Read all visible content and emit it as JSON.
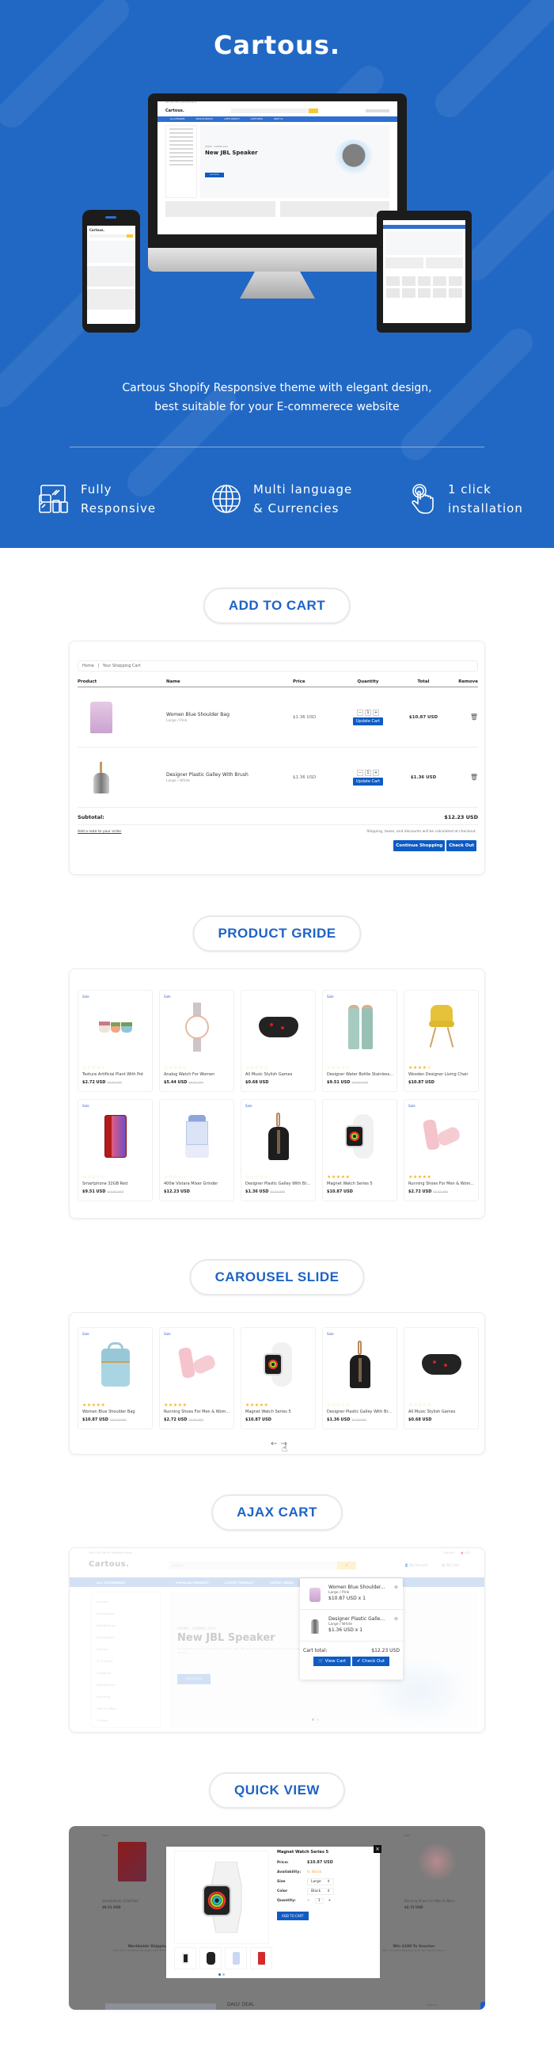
{
  "hero": {
    "title": "Cartous.",
    "description_line1": "Cartous Shopify Responsive theme with elegant design,",
    "description_line2": "best suitable for your E-commerece website",
    "mockup": {
      "promo_bar": "Get 20% Off On Selected Items",
      "logo": "Cartous.",
      "nav": [
        "ALL CATEGORIES",
        "POPULAR PRODUCT",
        "LATEST PRODUCT",
        "LATEST NEWS",
        "ABOUT US"
      ],
      "banner_kicker": "SPRING - SUMMER 2020",
      "banner_title": "New JBL Speaker",
      "banner_button": "SHOP NOW"
    },
    "features": [
      {
        "icon": "responsive-devices-icon",
        "line1": "Fully",
        "line2": "Responsive"
      },
      {
        "icon": "globe-icon",
        "line1": "Multi language",
        "line2": "& Currencies"
      },
      {
        "icon": "touch-click-icon",
        "line1": "1 click",
        "line2": "installation"
      }
    ]
  },
  "sections": {
    "add_to_cart": "ADD TO CART",
    "product_grid": "PRODUCT GRIDE",
    "carousel": "CAROUSEL SLIDE",
    "ajax_cart": "AJAX CART",
    "quick_view": "QUICK VIEW"
  },
  "cart": {
    "breadcrumb": {
      "home": "Home",
      "separator": "|",
      "current": "Your Shopping Cart"
    },
    "columns": [
      "Product",
      "Name",
      "Price",
      "Quantity",
      "Total",
      "Remove"
    ],
    "rows": [
      {
        "name": "Women Blue Shoulder Bag",
        "variant": "Large / Pink",
        "price": "$1.36 USD",
        "qty": "1",
        "total": "$10.87 USD",
        "update_label": "Update Cart",
        "image": "pink-backpack"
      },
      {
        "name": "Designer Plastic Galley With Brush",
        "variant": "Large / White",
        "price": "$1.36 USD",
        "qty": "1",
        "total": "$1.36 USD",
        "update_label": "Update Cart",
        "image": "dustpan-brush"
      }
    ],
    "subtotal_label": "Subtotal:",
    "subtotal_value": "$12.23 USD",
    "note_link": "Add a note to your order",
    "shipping_note": "Shipping, taxes, and discounts will be calculated at checkout.",
    "continue_button": "Continue Shopping",
    "checkout_button": "Check Out"
  },
  "product_grid": {
    "products": [
      {
        "name": "Texture Artificial Plant With Pot",
        "price": "$2.72 USD",
        "old_price": "$3.77 USD",
        "sale": true,
        "rating": 0,
        "image": "succulent-pots",
        "sale_label": "Sale"
      },
      {
        "name": "Analog Watch For Women",
        "price": "$5.44 USD",
        "old_price": "$6.77 USD",
        "sale": true,
        "rating": 0,
        "image": "analog-watch",
        "sale_label": "Sale"
      },
      {
        "name": "All Music Stylish Games",
        "price": "$0.68 USD",
        "old_price": "",
        "sale": false,
        "rating": 0,
        "image": "game-controller",
        "sale_label": ""
      },
      {
        "name": "Designer Water Bottle Stainless...",
        "price": "$9.51 USD",
        "old_price": "$10.87 USD",
        "sale": true,
        "rating": 0,
        "image": "water-bottles",
        "sale_label": "Sale"
      },
      {
        "name": "Wooden Designer Living Chair",
        "price": "$10.87 USD",
        "old_price": "",
        "sale": false,
        "rating": 4,
        "image": "yellow-chair",
        "sale_label": ""
      },
      {
        "name": "Smartphone 32GB Red",
        "price": "$9.51 USD",
        "old_price": "$10.87 USD",
        "sale": true,
        "rating": 0,
        "image": "red-smartphone",
        "sale_label": "Sale"
      },
      {
        "name": "400w Vistara Mixer Grinder",
        "price": "$12.23 USD",
        "old_price": "",
        "sale": false,
        "rating": 0,
        "image": "mixer-grinder",
        "sale_label": ""
      },
      {
        "name": "Designer Plastic Galley With Br...",
        "price": "$1.36 USD",
        "old_price": "$2.72 USD",
        "sale": true,
        "rating": 0,
        "image": "dustpan-brush",
        "sale_label": "Sale"
      },
      {
        "name": "Magnet Watch Series 5",
        "price": "$10.87 USD",
        "old_price": "",
        "sale": false,
        "rating": 5,
        "image": "smart-watch",
        "sale_label": ""
      },
      {
        "name": "Running Shoes For Men & Wom...",
        "price": "$2.72 USD",
        "old_price": "$3.77 USD",
        "sale": true,
        "rating": 5,
        "image": "pink-sneakers",
        "sale_label": "Sale"
      }
    ]
  },
  "carousel": {
    "products": [
      {
        "name": "Women Blue Shoulder Bag",
        "price": "$10.87 USD",
        "old_price": "$12.23 USD",
        "sale": true,
        "rating": 5,
        "image": "blue-backpack",
        "sale_label": "Sale"
      },
      {
        "name": "Running Shoes For Men & Wom...",
        "price": "$2.72 USD",
        "old_price": "$3.77 USD",
        "sale": true,
        "rating": 5,
        "image": "pink-sneakers",
        "sale_label": "Sale"
      },
      {
        "name": "Magnet Watch Series 5",
        "price": "$10.87 USD",
        "old_price": "",
        "sale": false,
        "rating": 5,
        "image": "smart-watch",
        "sale_label": ""
      },
      {
        "name": "Designer Plastic Galley With Br...",
        "price": "$1.36 USD",
        "old_price": "$2.72 USD",
        "sale": true,
        "rating": 0,
        "image": "dustpan-brush",
        "sale_label": "Sale"
      },
      {
        "name": "All Music Stylish Games",
        "price": "$0.68 USD",
        "old_price": "",
        "sale": false,
        "rating": 0,
        "image": "game-controller",
        "sale_label": ""
      }
    ],
    "prev_icon": "arrow-left-icon",
    "next_icon": "arrow-right-icon"
  },
  "ajax_cart": {
    "promo_bar": "Get 20% Off On Selected Items",
    "wishlist": "Wishlist",
    "currency": "USD",
    "logo": "Cartous.",
    "search_placeholder": "Search...",
    "account": "My Account",
    "cart": "My Cart",
    "nav": [
      "ALL CATEGORIES",
      "POPULAR PRODUCT",
      "LATEST PRODUCT",
      "LATEST NEWS",
      "ABOUT US"
    ],
    "categories": [
      "Camera",
      "Accessories",
      "Headphones",
      "Smartwatch",
      "Fashion",
      "Tv & Audio",
      "Computer",
      "Headphones",
      "Handbag",
      "Sale & Offers",
      "+ More"
    ],
    "banner_kicker": "SPRING - SUMMER 2020",
    "banner_title": "New JBL Speaker",
    "banner_text": "Sed sit quam, iaculis sed semper id amet odio vitae nibh, at magna sem perfusce vitae nibh id sit quam, iaculis sed semper...",
    "banner_button": "SHOP NOW",
    "dropdown": {
      "items": [
        {
          "name": "Women Blue Shoulder...",
          "variant": "Large / Pink",
          "price_qty": "$10.87 USD x 1",
          "image": "pink-backpack"
        },
        {
          "name": "Designer Plastic Galle...",
          "variant": "Large / White",
          "price_qty": "$1.36 USD x 1",
          "image": "dustpan-brush"
        }
      ],
      "total_label": "Cart total:",
      "total_value": "$12.23 USD",
      "view_cart": "View Cart",
      "check_out": "Check Out"
    }
  },
  "quick_view": {
    "product_name": "Magnet Watch Series 5",
    "price_label": "Price:",
    "price": "$10.87 USD",
    "availability_label": "Availability:",
    "availability": "In Stock",
    "size_label": "Size",
    "size": "Large",
    "color_label": "Color",
    "color": "Black",
    "quantity_label": "Quantity:",
    "quantity": "1",
    "add_to_cart": "ADD TO CART",
    "thumbnails": [
      "white-watch",
      "black-watch",
      "mixer-grinder",
      "red-smartphone"
    ],
    "bg_products": [
      {
        "name": "Smartphone 32GB Red",
        "price": "$9.51 USD",
        "sale_label": "Sale"
      },
      {
        "name": "Running Shoes For Men & Wom...",
        "price": "$2.72 USD",
        "sale_label": "Sale"
      }
    ],
    "bg_features": [
      {
        "title": "Worldwide Shipping",
        "text": "There Many Variations Passages Lorem Not Majority Have..."
      },
      {
        "title": "Win $100 To Voucher",
        "text": "Many Variations Passages Lorem Not Majority Have..."
      }
    ],
    "bg_daily_deal": "DAILY DEAL",
    "bg_view_all": "VIEW ALL"
  },
  "colors": {
    "brand_blue": "#2168c4",
    "button_blue": "#0f5bc4",
    "star": "#f5b52e",
    "search_yellow": "#f9c933"
  }
}
